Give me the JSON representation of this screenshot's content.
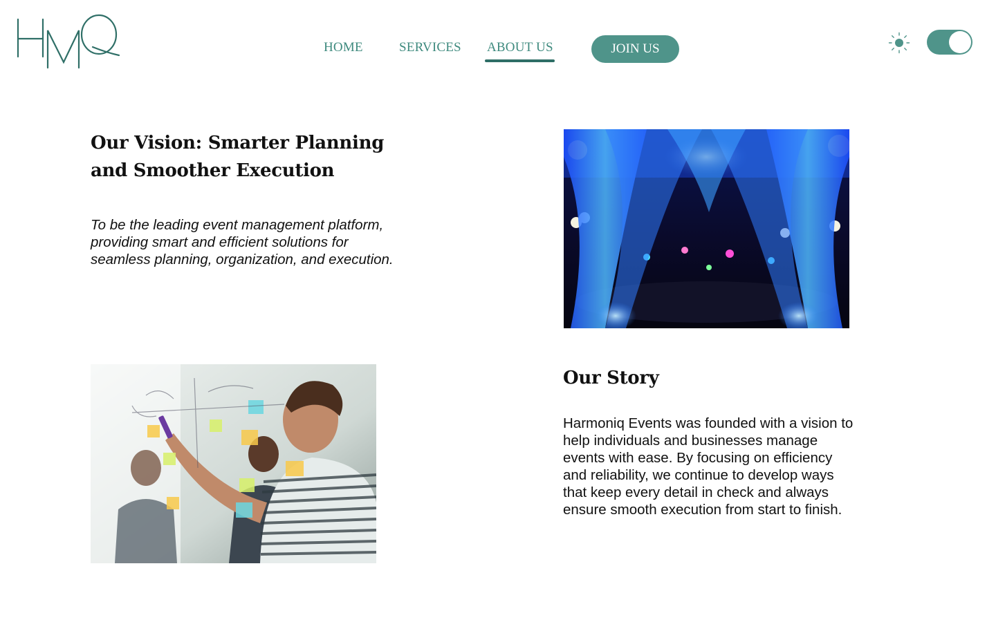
{
  "brand": {
    "logo_letters": "HMQ"
  },
  "nav": {
    "items": [
      {
        "label": "HOME"
      },
      {
        "label": "SERVICES"
      },
      {
        "label": "ABOUT US"
      }
    ],
    "active": "ABOUT US",
    "join_label": "JOIN US"
  },
  "theme": {
    "icon": "sun-icon",
    "toggle_state": "on"
  },
  "vision": {
    "heading": "Our Vision: Smarter Planning and Smoother Execution",
    "text": "To be the leading event management platform, providing smart and efficient solutions for seamless planning, organization, and execution."
  },
  "story": {
    "heading": "Our Story",
    "text": "Harmoniq Events was founded with a vision to help individuals and businesses manage events with ease. By focusing on efficiency and reliability, we continue to develop ways that keep every detail in check and always ensure smooth execution from start to finish."
  },
  "images": {
    "venue": "event-venue-photo",
    "team": "team-planning-photo"
  },
  "colors": {
    "brand_teal": "#4f948a",
    "nav_text": "#3e8a7e",
    "active_underline": "#2e6e66",
    "logo": "#2f6f67"
  }
}
